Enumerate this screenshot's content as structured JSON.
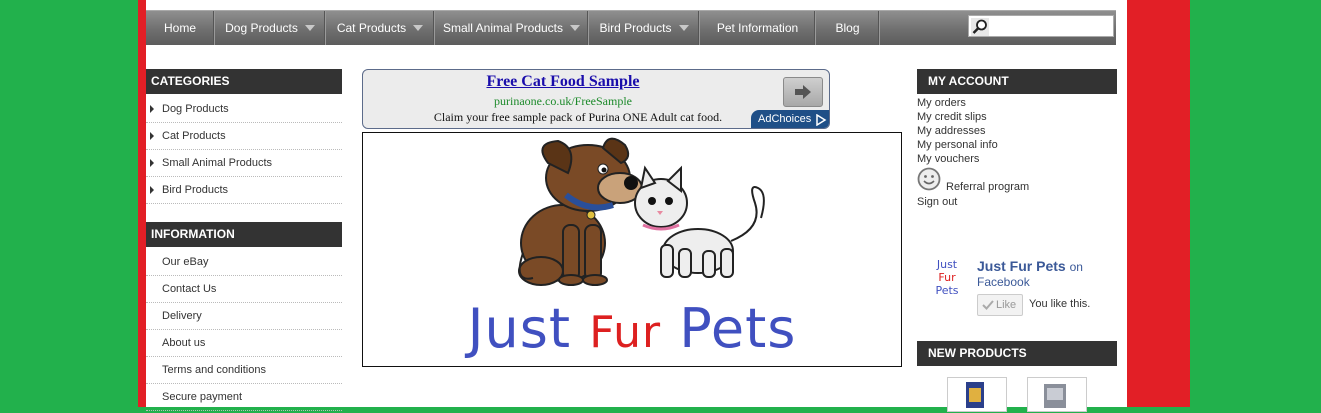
{
  "nav": {
    "items": [
      {
        "label": "Home",
        "dropdown": false
      },
      {
        "label": "Dog Products",
        "dropdown": true
      },
      {
        "label": "Cat Products",
        "dropdown": true
      },
      {
        "label": "Small Animal Products",
        "dropdown": true
      },
      {
        "label": "Bird Products",
        "dropdown": true
      },
      {
        "label": "Pet Information",
        "dropdown": false
      },
      {
        "label": "Blog",
        "dropdown": false
      }
    ],
    "search_value": ""
  },
  "categories": {
    "title": "CATEGORIES",
    "items": [
      "Dog Products",
      "Cat Products",
      "Small Animal Products",
      "Bird Products"
    ]
  },
  "information": {
    "title": "INFORMATION",
    "items": [
      "Our eBay",
      "Contact Us",
      "Delivery",
      "About us",
      "Terms and conditions",
      "Secure payment"
    ]
  },
  "ad": {
    "title": "Free Cat Food Sample",
    "url": "purinaone.co.uk/FreeSample",
    "text": "Claim your free sample pack of Purina ONE Adult cat food.",
    "adchoices": "AdChoices"
  },
  "banner": {
    "brand_word1": "Just",
    "brand_word2": "Fur",
    "brand_word3": "Pets"
  },
  "account": {
    "title": "MY ACCOUNT",
    "links": [
      "My orders",
      "My credit slips",
      "My addresses",
      "My personal info",
      "My vouchers"
    ],
    "referral": "Referral program",
    "signout": "Sign out"
  },
  "facebook": {
    "logo_lines": [
      "Just",
      "Fur",
      "Pets"
    ],
    "page_name": "Just Fur Pets",
    "on": "on",
    "network": "Facebook",
    "like_label": "Like",
    "you_like": "You like this."
  },
  "new_products": {
    "title": "NEW PRODUCTS"
  },
  "colors": {
    "background": "#22b14c",
    "frame": "#e21f26",
    "header_block": "#333333",
    "brand_blue": "#4050c0",
    "brand_red": "#dd2020"
  }
}
